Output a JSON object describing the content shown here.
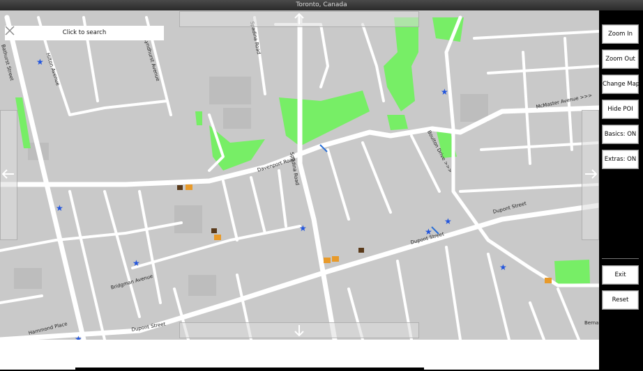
{
  "window": {
    "title": "Toronto, Canada"
  },
  "search": {
    "placeholder": "Click to search"
  },
  "buttons": {
    "zoom_in": "Zoom In",
    "zoom_out": "Zoom Out",
    "change_map": "Change Map",
    "hide_poi": "Hide POI",
    "basics": "Basics: ON",
    "extras": "Extras: ON",
    "exit": "Exit",
    "reset": "Reset"
  },
  "map": {
    "street_labels": {
      "bathurst": "Bathurst Street",
      "hilton": "Hilton Avenue",
      "lyndhurst": "Lyndhurst Avenue",
      "spadina_top": "Spadina Road",
      "spadina_mid": "Spadina Road",
      "davenport": "Davenport Road",
      "mcmaster": "McMaster Avenue >>>",
      "boulton": "Boulton Drive >>>",
      "dupont_right": "Dupont Street",
      "dupont_mid": "Dupont Street",
      "dupont_left": "Dupont Street",
      "bridgman": "Bridgman Avenue",
      "hammond": "Hammond Place",
      "bernard": "Berna"
    },
    "colors": {
      "background": "#c9c9c9",
      "road": "#ffffff",
      "park": "#77ee66",
      "poi_star": "#2255dd",
      "poi_food": "#e89a2a"
    },
    "icons": [
      "star-poi-icon",
      "coffee-icon",
      "restaurant-icon",
      "transit-icon"
    ]
  },
  "nav": {
    "up": "arrow-up-icon",
    "down": "arrow-down-icon",
    "left": "arrow-left-icon",
    "right": "arrow-right-icon"
  }
}
